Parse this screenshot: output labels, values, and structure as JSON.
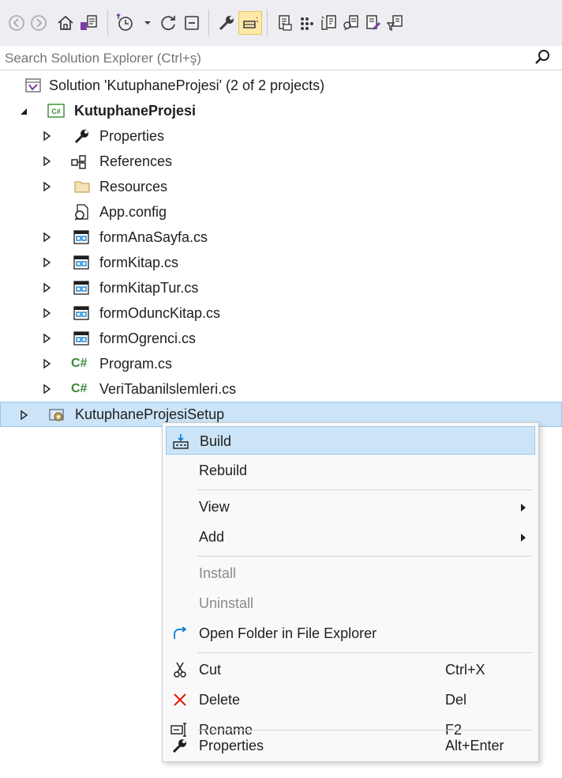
{
  "toolbar": {
    "buttons": [
      "back-icon",
      "forward-icon",
      "home-icon",
      "switch-views-icon",
      "pending-changes-filter-icon",
      "sync-icon",
      "collapse-all-icon",
      "properties-icon",
      "preview-selected-items-icon",
      "show-all-files-icon",
      "view-code-icon",
      "view-designer-icon",
      "view-class-diagram-icon",
      "filter-icon"
    ]
  },
  "search": {
    "placeholder": "Search Solution Explorer (Ctrl+ş)"
  },
  "tree": {
    "solution": "Solution 'KutuphaneProjesi' (2 of 2 projects)",
    "project": "KutuphaneProjesi",
    "items": [
      {
        "label": "Properties",
        "icon": "wrench-icon"
      },
      {
        "label": "References",
        "icon": "references-icon"
      },
      {
        "label": "Resources",
        "icon": "folder-icon"
      },
      {
        "label": "App.config",
        "icon": "config-file-icon"
      },
      {
        "label": "formAnaSayfa.cs",
        "icon": "form-icon"
      },
      {
        "label": "formKitap.cs",
        "icon": "form-icon"
      },
      {
        "label": "formKitapTur.cs",
        "icon": "form-icon"
      },
      {
        "label": "formOduncKitap.cs",
        "icon": "form-icon"
      },
      {
        "label": "formOgrenci.cs",
        "icon": "form-icon"
      },
      {
        "label": "Program.cs",
        "icon": "csharp-file-icon"
      },
      {
        "label": "VeriTabanilslemleri.cs",
        "icon": "csharp-file-icon"
      }
    ],
    "setup_project": "KutuphaneProjesiSetup",
    "csharp_badge": "C#"
  },
  "context_menu": {
    "items": [
      {
        "label": "Build",
        "shortcut": "",
        "icon": "build-icon"
      },
      {
        "label": "Rebuild",
        "shortcut": "",
        "icon": ""
      },
      {
        "label": "View",
        "shortcut": "",
        "icon": ""
      },
      {
        "label": "Add",
        "shortcut": "",
        "icon": ""
      },
      {
        "label": "Install",
        "shortcut": "",
        "icon": ""
      },
      {
        "label": "Uninstall",
        "shortcut": "",
        "icon": ""
      },
      {
        "label": "Open Folder in File Explorer",
        "shortcut": "",
        "icon": "open-folder-arrow-icon"
      },
      {
        "label": "Cut",
        "shortcut": "Ctrl+X",
        "icon": "scissors-icon"
      },
      {
        "label": "Delete",
        "shortcut": "Del",
        "icon": "delete-x-icon"
      },
      {
        "label": "Rename",
        "shortcut": "F2",
        "icon": "rename-icon"
      },
      {
        "label": "Properties",
        "shortcut": "Alt+Enter",
        "icon": "wrench-icon"
      }
    ]
  },
  "colors": {
    "selection": "#cce4f7",
    "accent": "#0078d4",
    "csharp": "#388a34",
    "delete": "#e51400",
    "folder": "#dcb67a"
  }
}
